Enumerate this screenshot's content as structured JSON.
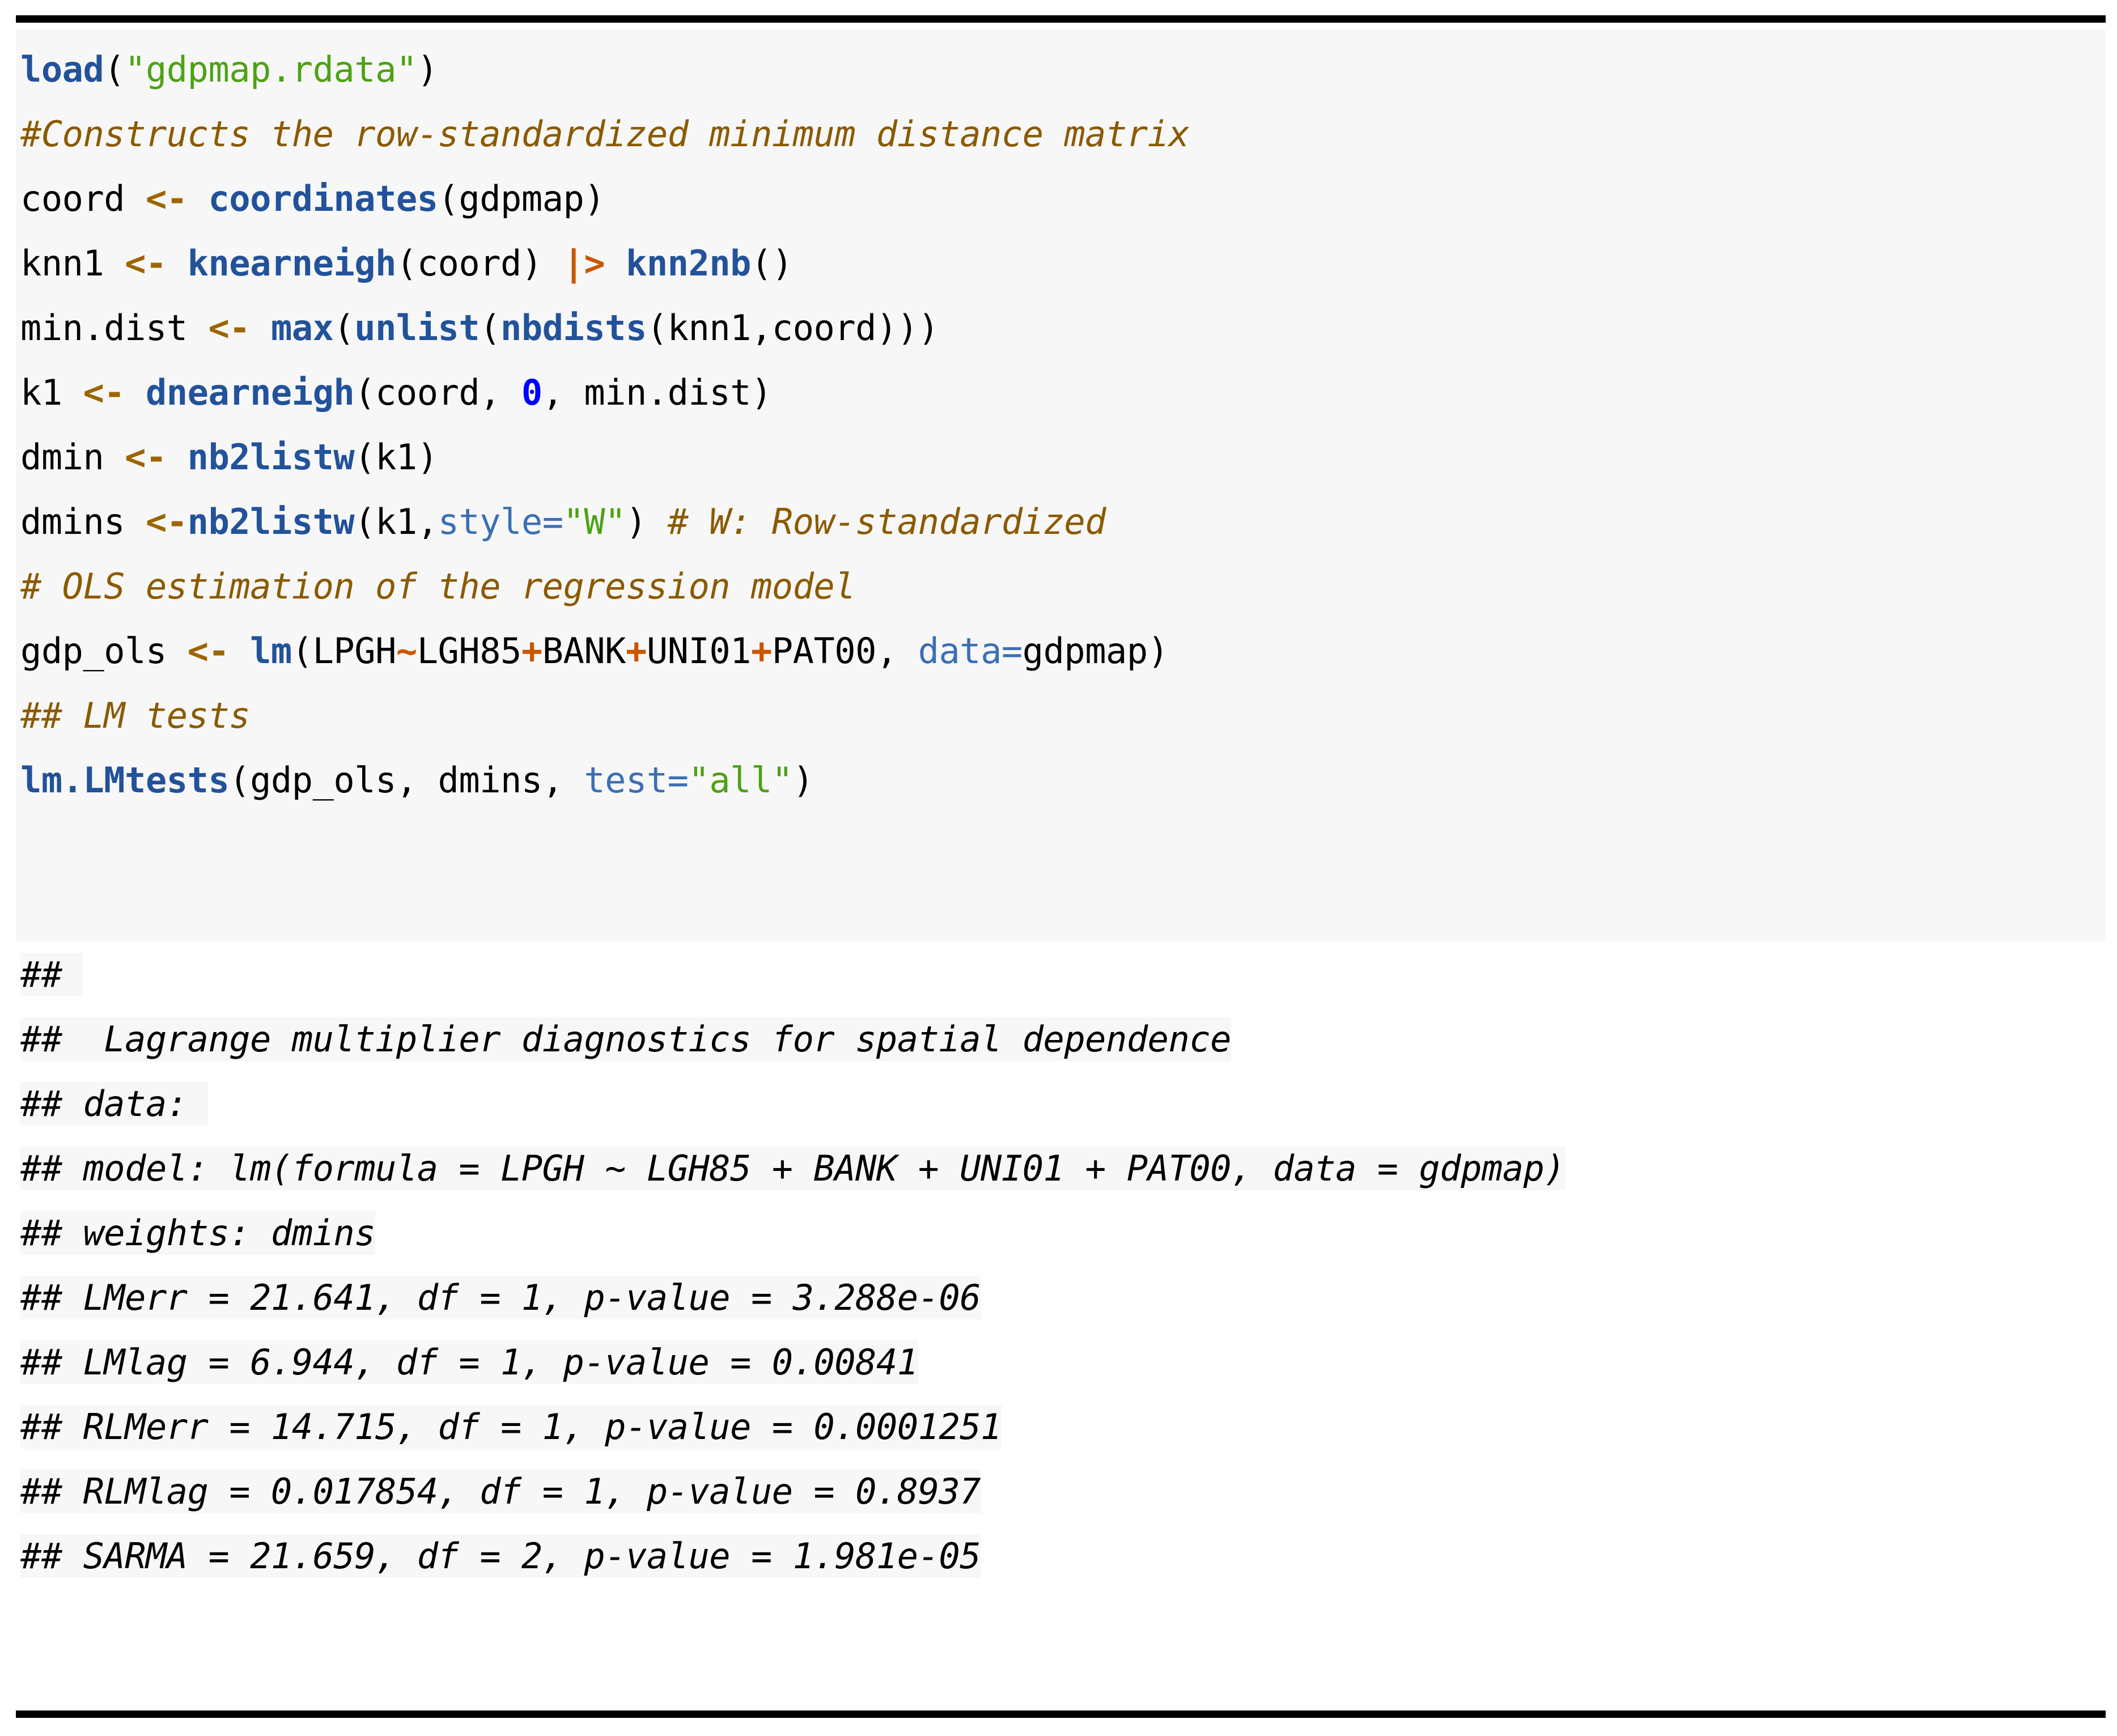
{
  "document": {
    "kind": "r-markdown-code-chunk",
    "language": "R",
    "rule_color": "#000000",
    "code_background": "#f7f7f7",
    "page_background": "#ffffff"
  },
  "theme": {
    "function_color": "#22529a",
    "string_color": "#4ca213",
    "comment_color": "#8b5a00",
    "assign_color": "#9c6500",
    "pipe_color": "#cc5500",
    "argument_color": "#3b6fb5",
    "number_color": "#0000ff",
    "operator_color": "#cc5500",
    "plain_color": "#000000"
  },
  "code": {
    "lines": [
      {
        "id": "line-load",
        "text": "load(\"gdpmap.rdata\")",
        "tokens": [
          {
            "t": "fn",
            "v": "load"
          },
          {
            "t": "plain",
            "v": "("
          },
          {
            "t": "str",
            "v": "\"gdpmap.rdata\""
          },
          {
            "t": "plain",
            "v": ")"
          }
        ]
      },
      {
        "id": "line-comment-1",
        "text": "#Constructs the row-standardized minimum distance matrix",
        "tokens": [
          {
            "t": "cmt",
            "v": "#Constructs the row-standardized minimum distance matrix"
          }
        ]
      },
      {
        "id": "line-coord",
        "text": "coord <- coordinates(gdpmap)",
        "tokens": [
          {
            "t": "plain",
            "v": "coord "
          },
          {
            "t": "asn",
            "v": "<-"
          },
          {
            "t": "plain",
            "v": " "
          },
          {
            "t": "fn",
            "v": "coordinates"
          },
          {
            "t": "plain",
            "v": "(gdpmap)"
          }
        ]
      },
      {
        "id": "line-knn1",
        "text": "knn1 <- knearneigh(coord) |> knn2nb()",
        "tokens": [
          {
            "t": "plain",
            "v": "knn1 "
          },
          {
            "t": "asn",
            "v": "<-"
          },
          {
            "t": "plain",
            "v": " "
          },
          {
            "t": "fn",
            "v": "knearneigh"
          },
          {
            "t": "plain",
            "v": "(coord) "
          },
          {
            "t": "pipe",
            "v": "|>"
          },
          {
            "t": "plain",
            "v": " "
          },
          {
            "t": "fn",
            "v": "knn2nb"
          },
          {
            "t": "plain",
            "v": "()"
          }
        ]
      },
      {
        "id": "line-mindist",
        "text": "min.dist <- max(unlist(nbdists(knn1,coord)))",
        "tokens": [
          {
            "t": "plain",
            "v": "min.dist "
          },
          {
            "t": "asn",
            "v": "<-"
          },
          {
            "t": "plain",
            "v": " "
          },
          {
            "t": "fn",
            "v": "max"
          },
          {
            "t": "plain",
            "v": "("
          },
          {
            "t": "fn",
            "v": "unlist"
          },
          {
            "t": "plain",
            "v": "("
          },
          {
            "t": "fn",
            "v": "nbdists"
          },
          {
            "t": "plain",
            "v": "(knn1,coord)))"
          }
        ]
      },
      {
        "id": "line-k1",
        "text": "k1 <- dnearneigh(coord, 0, min.dist)",
        "tokens": [
          {
            "t": "plain",
            "v": "k1 "
          },
          {
            "t": "asn",
            "v": "<-"
          },
          {
            "t": "plain",
            "v": " "
          },
          {
            "t": "fn",
            "v": "dnearneigh"
          },
          {
            "t": "plain",
            "v": "(coord, "
          },
          {
            "t": "num",
            "v": "0"
          },
          {
            "t": "plain",
            "v": ", min.dist)"
          }
        ]
      },
      {
        "id": "line-dmin",
        "text": "dmin <- nb2listw(k1)",
        "tokens": [
          {
            "t": "plain",
            "v": "dmin "
          },
          {
            "t": "asn",
            "v": "<-"
          },
          {
            "t": "plain",
            "v": " "
          },
          {
            "t": "fn",
            "v": "nb2listw"
          },
          {
            "t": "plain",
            "v": "(k1)"
          }
        ]
      },
      {
        "id": "line-dmins",
        "text": "dmins <-nb2listw(k1,style=\"W\") # W: Row-standardized",
        "tokens": [
          {
            "t": "plain",
            "v": "dmins "
          },
          {
            "t": "asn",
            "v": "<-"
          },
          {
            "t": "fn",
            "v": "nb2listw"
          },
          {
            "t": "plain",
            "v": "(k1,"
          },
          {
            "t": "arg",
            "v": "style="
          },
          {
            "t": "str",
            "v": "\"W\""
          },
          {
            "t": "plain",
            "v": ") "
          },
          {
            "t": "cmt",
            "v": "# W: Row-standardized"
          }
        ]
      },
      {
        "id": "line-comment-2",
        "text": "# OLS estimation of the regression model",
        "tokens": [
          {
            "t": "cmt",
            "v": "# OLS estimation of the regression model"
          }
        ]
      },
      {
        "id": "line-gdpols",
        "text": "gdp_ols <- lm(LPGH~LGH85+BANK+UNI01+PAT00, data=gdpmap)",
        "tokens": [
          {
            "t": "plain",
            "v": "gdp_ols "
          },
          {
            "t": "asn",
            "v": "<-"
          },
          {
            "t": "plain",
            "v": " "
          },
          {
            "t": "fn",
            "v": "lm"
          },
          {
            "t": "plain",
            "v": "(LPGH"
          },
          {
            "t": "op",
            "v": "~"
          },
          {
            "t": "plain",
            "v": "LGH85"
          },
          {
            "t": "op",
            "v": "+"
          },
          {
            "t": "plain",
            "v": "BANK"
          },
          {
            "t": "op",
            "v": "+"
          },
          {
            "t": "plain",
            "v": "UNI01"
          },
          {
            "t": "op",
            "v": "+"
          },
          {
            "t": "plain",
            "v": "PAT00, "
          },
          {
            "t": "arg",
            "v": "data="
          },
          {
            "t": "plain",
            "v": "gdpmap)"
          }
        ]
      },
      {
        "id": "line-comment-3",
        "text": "## LM tests",
        "tokens": [
          {
            "t": "cmt",
            "v": "## LM tests"
          }
        ]
      },
      {
        "id": "line-lmtests",
        "text": "lm.LMtests(gdp_ols, dmins, test=\"all\")",
        "tokens": [
          {
            "t": "fn",
            "v": "lm.LMtests"
          },
          {
            "t": "plain",
            "v": "(gdp_ols, dmins, "
          },
          {
            "t": "arg",
            "v": "test="
          },
          {
            "t": "str",
            "v": "\"all\""
          },
          {
            "t": "plain",
            "v": ")"
          }
        ]
      }
    ]
  },
  "output": {
    "lines": [
      {
        "id": "out-blank",
        "text": "## "
      },
      {
        "id": "out-title",
        "text": "##  Lagrange multiplier diagnostics for spatial dependence"
      },
      {
        "id": "out-data",
        "text": "## data: "
      },
      {
        "id": "out-model",
        "text": "## model: lm(formula = LPGH ~ LGH85 + BANK + UNI01 + PAT00, data = gdpmap)"
      },
      {
        "id": "out-weights",
        "text": "## weights: dmins"
      },
      {
        "id": "out-lmerr",
        "text": "## LMerr = 21.641, df = 1, p-value = 3.288e-06"
      },
      {
        "id": "out-lmlag",
        "text": "## LMlag = 6.944, df = 1, p-value = 0.00841"
      },
      {
        "id": "out-rlmerr",
        "text": "## RLMerr = 14.715, df = 1, p-value = 0.0001251"
      },
      {
        "id": "out-rlmlag",
        "text": "## RLMlag = 0.017854, df = 1, p-value = 0.8937"
      },
      {
        "id": "out-sarma",
        "text": "## SARMA = 21.659, df = 2, p-value = 1.981e-05"
      }
    ],
    "results": {
      "test_name": "Lagrange multiplier diagnostics for spatial dependence",
      "model": "lm(formula = LPGH ~ LGH85 + BANK + UNI01 + PAT00, data = gdpmap)",
      "weights": "dmins",
      "statistics": [
        {
          "name": "LMerr",
          "value": "21.641",
          "df": "1",
          "p_value": "3.288e-06"
        },
        {
          "name": "LMlag",
          "value": "6.944",
          "df": "1",
          "p_value": "0.00841"
        },
        {
          "name": "RLMerr",
          "value": "14.715",
          "df": "1",
          "p_value": "0.0001251"
        },
        {
          "name": "RLMlag",
          "value": "0.017854",
          "df": "1",
          "p_value": "0.8937"
        },
        {
          "name": "SARMA",
          "value": "21.659",
          "df": "2",
          "p_value": "1.981e-05"
        }
      ]
    }
  }
}
